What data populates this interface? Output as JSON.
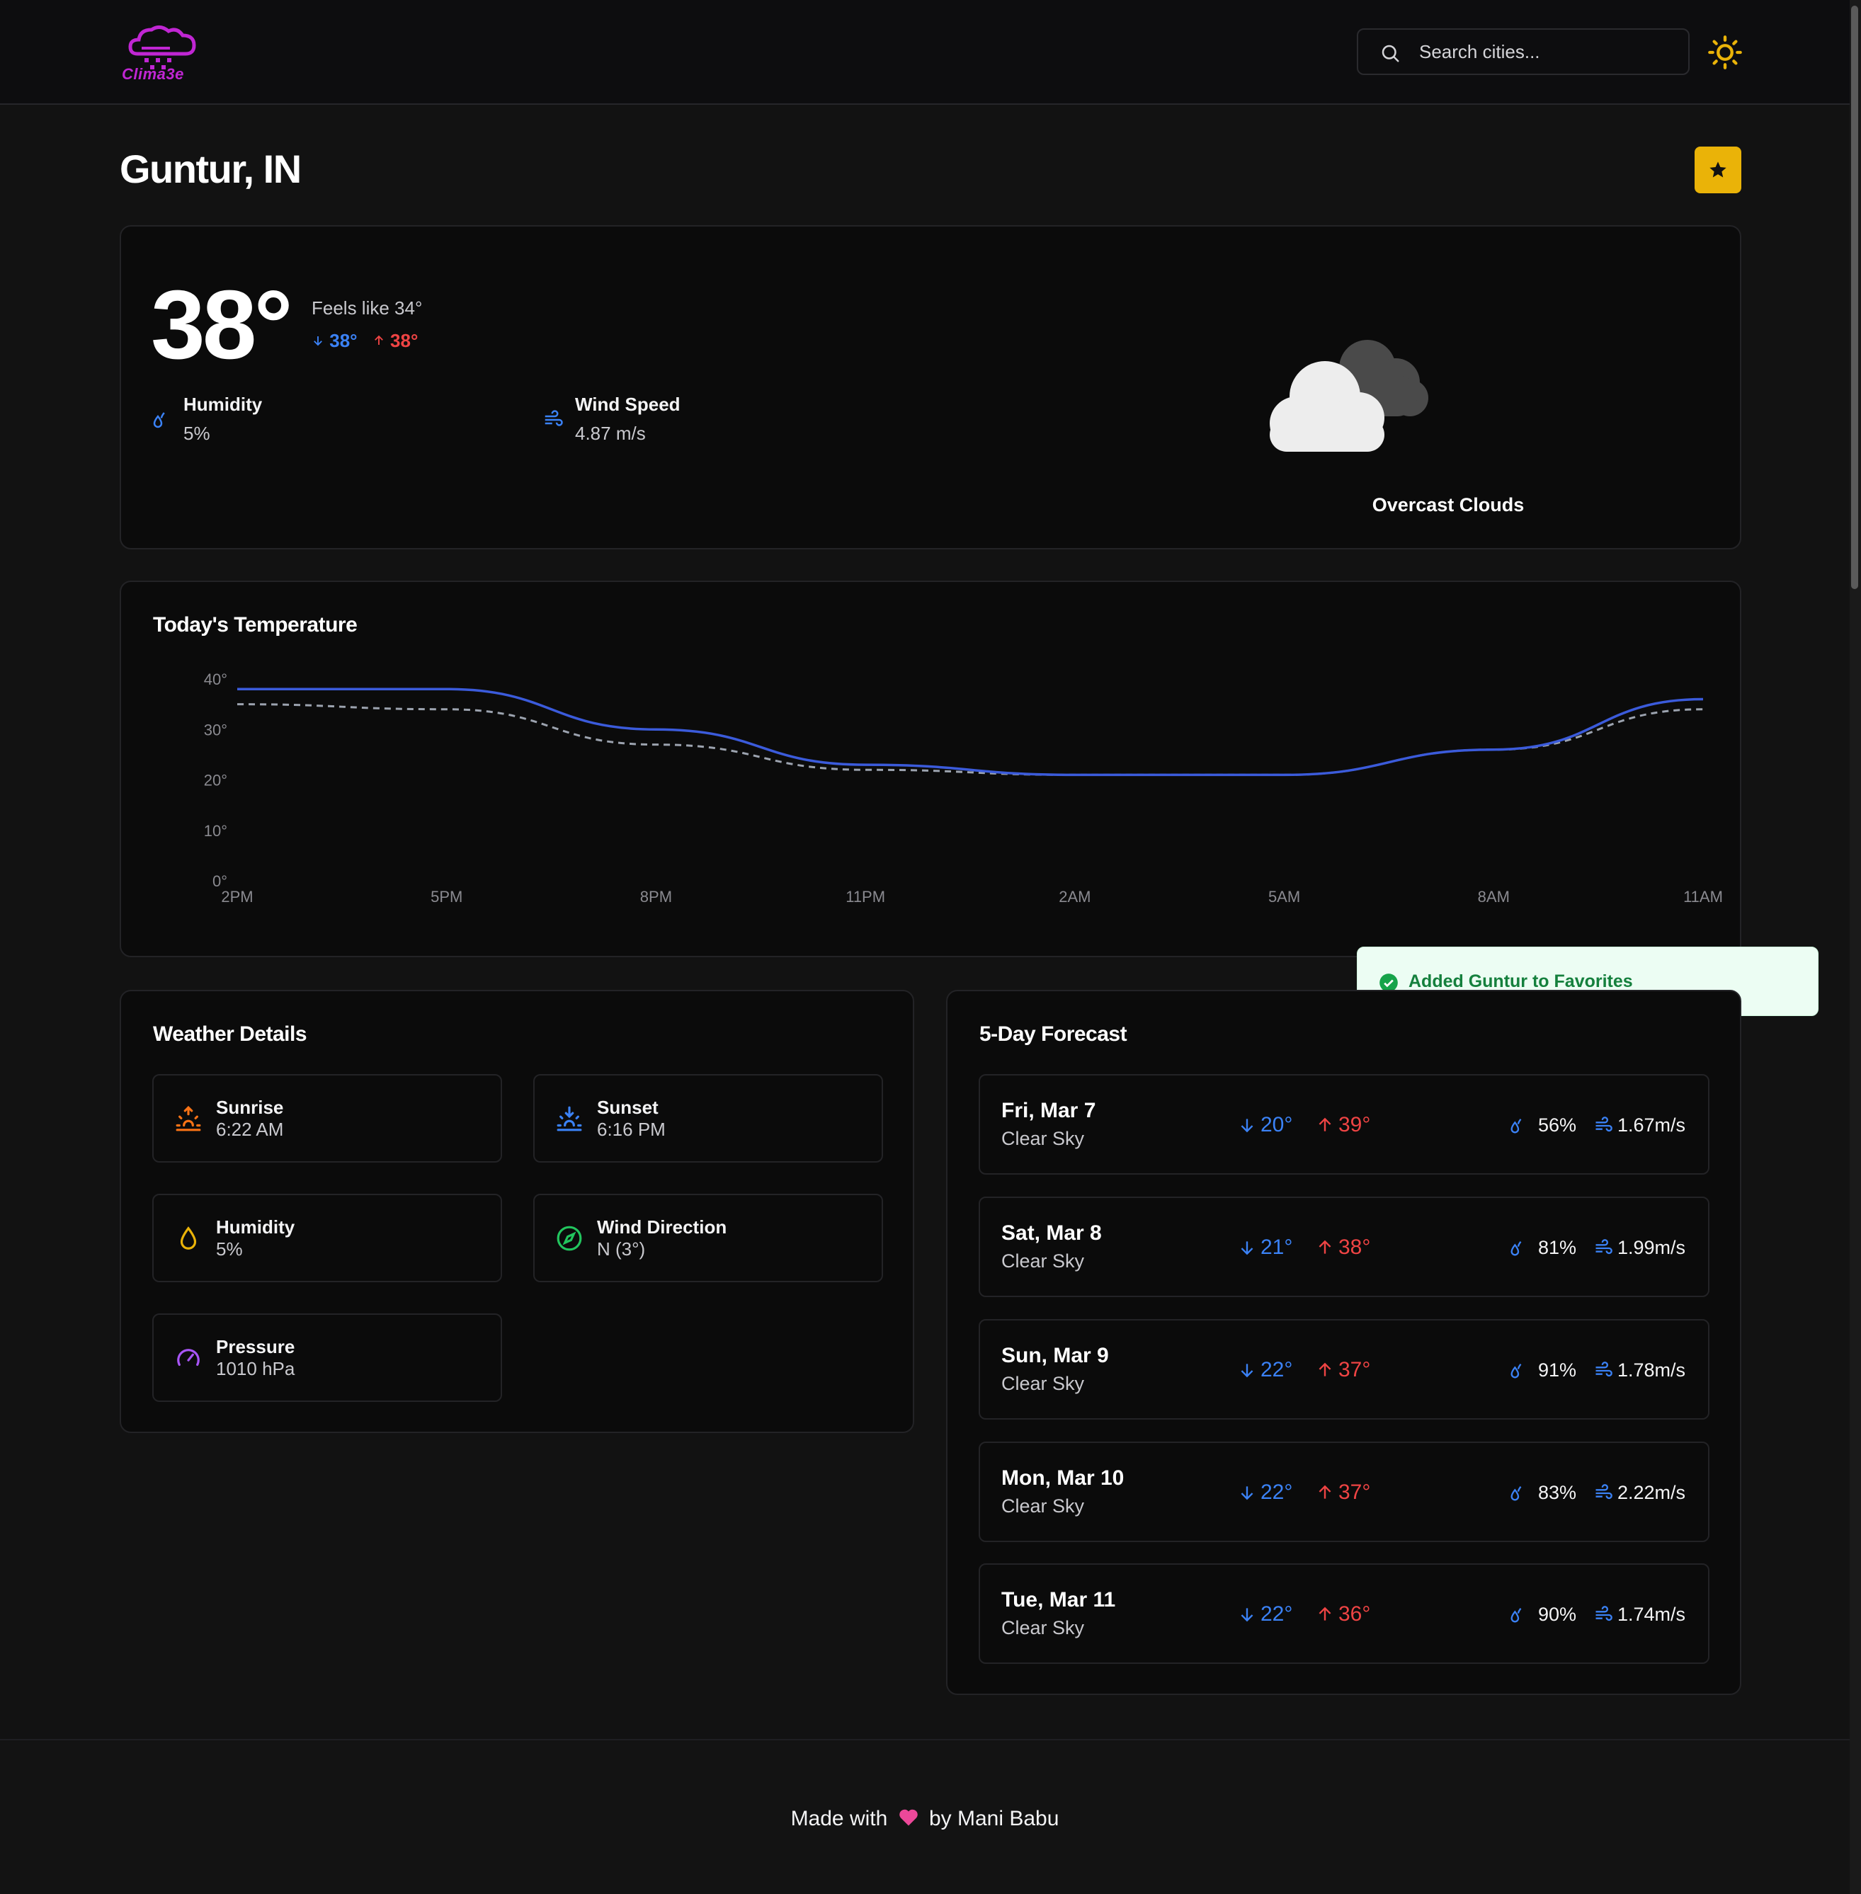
{
  "brand": {
    "name": "Clima3e",
    "color": "#c026d3"
  },
  "search": {
    "placeholder": "Search cities..."
  },
  "location": {
    "title": "Guntur, IN"
  },
  "current": {
    "temp": "38°",
    "feels_like": "Feels like 34°",
    "min": "38°",
    "max": "38°",
    "humidity_label": "Humidity",
    "humidity_value": "5%",
    "wind_label": "Wind Speed",
    "wind_value": "4.87 m/s",
    "condition": "Overcast Clouds"
  },
  "chart_card": {
    "title": "Today's Temperature"
  },
  "chart_data": {
    "type": "line",
    "title": "Today's Temperature",
    "categories": [
      "2PM",
      "5PM",
      "8PM",
      "11PM",
      "2AM",
      "5AM",
      "8AM",
      "11AM"
    ],
    "yticks": [
      "0°",
      "10°",
      "20°",
      "30°",
      "40°"
    ],
    "ylim": [
      0,
      40
    ],
    "series": [
      {
        "values": [
          38,
          38,
          30,
          23,
          21,
          21,
          26,
          36
        ],
        "color": "#3b5bdb",
        "style": "solid"
      },
      {
        "values": [
          35,
          34,
          27,
          22,
          21,
          21,
          26,
          34
        ],
        "color": "#9ca3af",
        "style": "dashed"
      }
    ],
    "grid": false
  },
  "toast": {
    "message": "Added Guntur to Favorites"
  },
  "details": {
    "title": "Weather Details",
    "items": [
      {
        "label": "Sunrise",
        "value": "6:22 AM",
        "icon": "sunrise-icon",
        "color": "#f97316"
      },
      {
        "label": "Sunset",
        "value": "6:16 PM",
        "icon": "sunset-icon",
        "color": "#3b82f6"
      },
      {
        "label": "Humidity",
        "value": "5%",
        "icon": "droplet-icon",
        "color": "#eab308"
      },
      {
        "label": "Wind Direction",
        "value": "N (3°)",
        "icon": "compass-icon",
        "color": "#22c55e"
      },
      {
        "label": "Pressure",
        "value": "1010 hPa",
        "icon": "gauge-icon",
        "color": "#a855f7"
      }
    ]
  },
  "forecast": {
    "title": "5-Day Forecast",
    "days": [
      {
        "day": "Fri, Mar 7",
        "desc": "Clear Sky",
        "lo": "20°",
        "hi": "39°",
        "hum": "56%",
        "wind": "1.67m/s"
      },
      {
        "day": "Sat, Mar 8",
        "desc": "Clear Sky",
        "lo": "21°",
        "hi": "38°",
        "hum": "81%",
        "wind": "1.99m/s"
      },
      {
        "day": "Sun, Mar 9",
        "desc": "Clear Sky",
        "lo": "22°",
        "hi": "37°",
        "hum": "91%",
        "wind": "1.78m/s"
      },
      {
        "day": "Mon, Mar 10",
        "desc": "Clear Sky",
        "lo": "22°",
        "hi": "37°",
        "hum": "83%",
        "wind": "2.22m/s"
      },
      {
        "day": "Tue, Mar 11",
        "desc": "Clear Sky",
        "lo": "22°",
        "hi": "36°",
        "hum": "90%",
        "wind": "1.74m/s"
      }
    ]
  },
  "footer": {
    "before": "Made with",
    "after": "by Mani Babu"
  }
}
